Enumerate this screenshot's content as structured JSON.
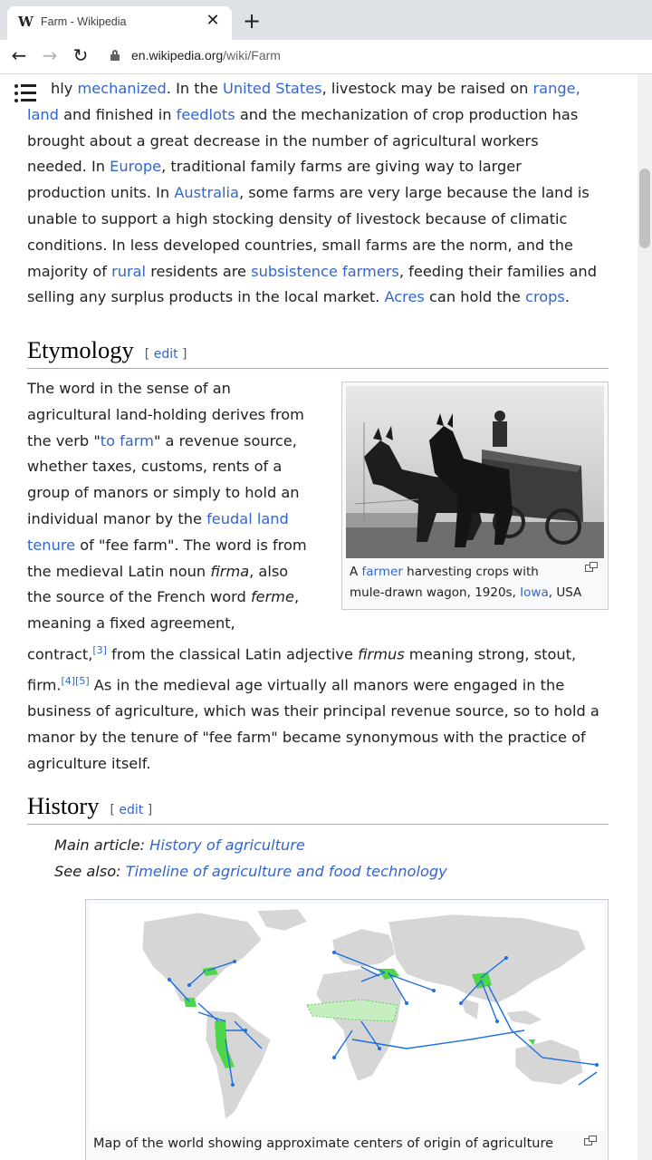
{
  "browser": {
    "tab_title": "Farm - Wikipedia",
    "favicon": "W",
    "close_glyph": "✕",
    "new_tab_glyph": "+",
    "back_glyph": "←",
    "forward_glyph": "→",
    "reload_glyph": "↻",
    "url_host": "en.wikipedia.org",
    "url_path": "/wiki/Farm"
  },
  "intro": {
    "l1_a": "hly ",
    "l1_link1": "mechanized",
    "l1_b": ". In the ",
    "l1_link2": "United States",
    "l1_c": ", livestock may be raised on ",
    "l1_link3": "range,",
    "l2_link1": "land",
    "l2_a": " and finished in ",
    "l2_link2": "feedlots",
    "l2_b": " and the mechanization of crop production has",
    "l3": "brought about a great decrease in the number of agricultural workers",
    "l4_a": "needed. In ",
    "l4_link": "Europe",
    "l4_b": ", traditional family farms are giving way to larger",
    "l5_a": "production units. In ",
    "l5_link": "Australia",
    "l5_b": ", some farms are very large because the land is",
    "l6": "unable to support a high stocking density of livestock because of climatic",
    "l7": "conditions. In less developed countries, small farms are the norm, and the",
    "l8_a": "majority of ",
    "l8_link1": "rural",
    "l8_b": " residents are ",
    "l8_link2": "subsistence farmers",
    "l8_c": ", feeding their families and",
    "l9_a": "selling any surplus products in the local market. ",
    "l9_link1": "Acres",
    "l9_b": " can hold the ",
    "l9_link2": "crops",
    "l9_c": "."
  },
  "etymology": {
    "heading": "Etymology",
    "edit_label": "edit",
    "bracket_open": "[",
    "bracket_close": "]",
    "n1": "The word in the sense of an",
    "n2": "agricultural land-holding derives from",
    "n3_a": "the verb \"",
    "n3_link": "to farm",
    "n3_b": "\" a revenue source,",
    "n4": "whether taxes, customs, rents of a",
    "n5": "group of manors or simply to hold an",
    "n6_a": "individual manor by the ",
    "n6_link": "feudal land",
    "n7_link": "tenure",
    "n7_b": " of \"fee farm\". The word is from",
    "n8_a": "the medieval Latin noun ",
    "n8_em": "firma",
    "n8_b": ", also",
    "n9_a": "the source of the French word ",
    "n9_em": "ferme",
    "n9_b": ",",
    "n10": "meaning a fixed agreement,",
    "w1_a": "contract,",
    "w1_ref": "[3]",
    "w1_b": " from the classical Latin adjective ",
    "w1_em": "firmus",
    "w1_c": " meaning strong, stout,",
    "w2_a": "firm.",
    "w2_ref": "[4][5]",
    "w2_b": " As in the medieval age virtually all manors were engaged in the",
    "w3": "business of agriculture, which was their principal revenue source, so to hold a",
    "w4": "manor by the tenure of \"fee farm\" became synonymous with the practice of",
    "w5": "agriculture itself.",
    "figure": {
      "cap1_a": "A ",
      "cap1_link": "farmer",
      "cap1_b": " harvesting crops with",
      "cap2_a": "mule-drawn wagon, 1920s, ",
      "cap2_link": "Iowa",
      "cap2_b": ", USA"
    }
  },
  "history": {
    "heading": "History",
    "edit_label": "edit",
    "main_label": "Main article: ",
    "main_link": "History of agriculture",
    "see_label": "See also: ",
    "see_link": "Timeline of agriculture and food technology",
    "map_caption": "Map of the world showing approximate centers of origin of agriculture",
    "colors": {
      "land": "#d6d6d6",
      "origin": "#4cd64c",
      "arrow": "#1f6fe0"
    }
  },
  "colors": {
    "link": "#3366cc",
    "text": "#202122",
    "rule": "#a2a9b1"
  }
}
